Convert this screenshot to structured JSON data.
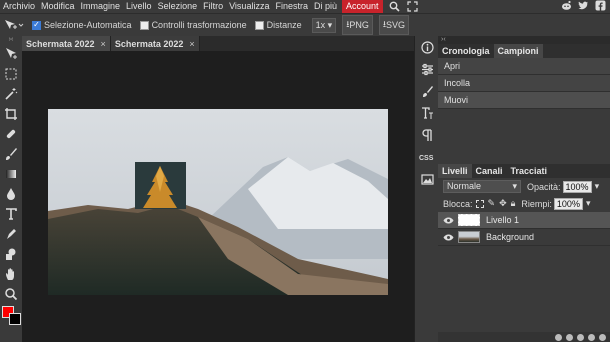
{
  "menu": {
    "items": [
      "Archivio",
      "Modifica",
      "Immagine",
      "Livello",
      "Selezione",
      "Filtro",
      "Visualizza",
      "Finestra",
      "Di più"
    ],
    "account": "Account"
  },
  "options": {
    "auto_select": "Selezione-Automatica",
    "auto_select_checked": true,
    "transform_controls": "Controlli trasformazione",
    "transform_controls_checked": false,
    "distances": "Distanze",
    "distances_checked": false,
    "zoom": "1x",
    "png_label": "PNG",
    "svg_label": "SVG"
  },
  "tabs": [
    {
      "label": "Schermata 2022",
      "close": "×"
    },
    {
      "label": "Schermata 2022",
      "close": "×"
    }
  ],
  "history": {
    "tabs": [
      "Cronologia",
      "Campioni"
    ],
    "items": [
      "Apri",
      "Incolla",
      "Muovi"
    ]
  },
  "layers": {
    "tabs": [
      "Livelli",
      "Canali",
      "Tracciati"
    ],
    "blend_mode": "Normale",
    "opacity_label": "Opacità:",
    "opacity_value": "100%",
    "lock_label": "Blocca:",
    "fill_label": "Riempi:",
    "fill_value": "100%",
    "items": [
      {
        "name": "Livello 1"
      },
      {
        "name": "Background"
      }
    ]
  },
  "colors": {
    "foreground": "#ff0000",
    "background": "#000000",
    "account": "#c8232b"
  }
}
